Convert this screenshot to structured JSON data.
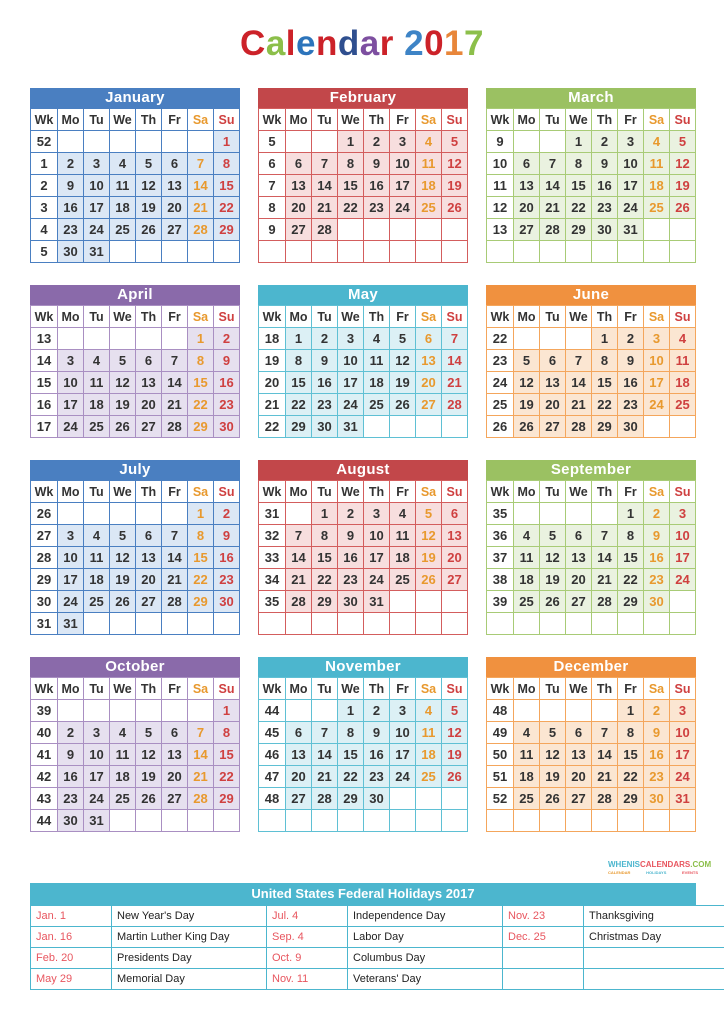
{
  "title": {
    "letters": [
      {
        "ch": "C",
        "color": "#cc2229"
      },
      {
        "ch": "a",
        "color": "#8cbf4a"
      },
      {
        "ch": "l",
        "color": "#cc2229"
      },
      {
        "ch": "e",
        "color": "#2c74bb"
      },
      {
        "ch": "n",
        "color": "#cc2229"
      },
      {
        "ch": "d",
        "color": "#2f4f8f"
      },
      {
        "ch": "a",
        "color": "#7d4fa0"
      },
      {
        "ch": "r",
        "color": "#cc2229"
      },
      {
        "ch": " ",
        "color": "#000000"
      },
      {
        "ch": "2",
        "color": "#3e84c6"
      },
      {
        "ch": "0",
        "color": "#cc2229"
      },
      {
        "ch": "1",
        "color": "#e8863a"
      },
      {
        "ch": "7",
        "color": "#8cbf4a"
      }
    ],
    "text": "Calendar 2017"
  },
  "weekday_headers": [
    "Wk",
    "Mo",
    "Tu",
    "We",
    "Th",
    "Fr",
    "Sa",
    "Su"
  ],
  "palette": {
    "blue": {
      "header": "#4a7fc1",
      "border": "#4a7fc1",
      "tint": "#dbe7f5"
    },
    "red": {
      "header": "#c2474a",
      "border": "#d35d5d",
      "tint": "#f7dede"
    },
    "green": {
      "header": "#9bc162",
      "border": "#a8cb76",
      "tint": "#eaf2e0"
    },
    "purple": {
      "header": "#8a6aaa",
      "border": "#a98fc2",
      "tint": "#e6e0ef"
    },
    "cyan": {
      "header": "#4cb6ce",
      "border": "#5fc0d4",
      "tint": "#dcf0f5"
    },
    "orange": {
      "header": "#f0913f",
      "border": "#f4a65c",
      "tint": "#fbe6d2"
    },
    "saturday_text": "#e8992e",
    "sunday_text": "#cf4040",
    "day_text": "#333333"
  },
  "months": [
    {
      "name": "January",
      "color": "blue",
      "weeks": [
        {
          "wk": "52",
          "days": [
            "",
            "",
            "",
            "",
            "",
            "",
            "1"
          ]
        },
        {
          "wk": "1",
          "days": [
            "2",
            "3",
            "4",
            "5",
            "6",
            "7",
            "8"
          ]
        },
        {
          "wk": "2",
          "days": [
            "9",
            "10",
            "11",
            "12",
            "13",
            "14",
            "15"
          ]
        },
        {
          "wk": "3",
          "days": [
            "16",
            "17",
            "18",
            "19",
            "20",
            "21",
            "22"
          ]
        },
        {
          "wk": "4",
          "days": [
            "23",
            "24",
            "25",
            "26",
            "27",
            "28",
            "29"
          ]
        },
        {
          "wk": "5",
          "days": [
            "30",
            "31",
            "",
            "",
            "",
            "",
            ""
          ]
        }
      ]
    },
    {
      "name": "February",
      "color": "red",
      "weeks": [
        {
          "wk": "5",
          "days": [
            "",
            "",
            "1",
            "2",
            "3",
            "4",
            "5"
          ]
        },
        {
          "wk": "6",
          "days": [
            "6",
            "7",
            "8",
            "9",
            "10",
            "11",
            "12"
          ]
        },
        {
          "wk": "7",
          "days": [
            "13",
            "14",
            "15",
            "16",
            "17",
            "18",
            "19"
          ]
        },
        {
          "wk": "8",
          "days": [
            "20",
            "21",
            "22",
            "23",
            "24",
            "25",
            "26"
          ]
        },
        {
          "wk": "9",
          "days": [
            "27",
            "28",
            "",
            "",
            "",
            "",
            ""
          ]
        },
        {
          "wk": "",
          "days": [
            "",
            "",
            "",
            "",
            "",
            "",
            ""
          ]
        }
      ]
    },
    {
      "name": "March",
      "color": "green",
      "weeks": [
        {
          "wk": "9",
          "days": [
            "",
            "",
            "1",
            "2",
            "3",
            "4",
            "5"
          ]
        },
        {
          "wk": "10",
          "days": [
            "6",
            "7",
            "8",
            "9",
            "10",
            "11",
            "12"
          ]
        },
        {
          "wk": "11",
          "days": [
            "13",
            "14",
            "15",
            "16",
            "17",
            "18",
            "19"
          ]
        },
        {
          "wk": "12",
          "days": [
            "20",
            "21",
            "22",
            "23",
            "24",
            "25",
            "26"
          ]
        },
        {
          "wk": "13",
          "days": [
            "27",
            "28",
            "29",
            "30",
            "31",
            "",
            ""
          ]
        },
        {
          "wk": "",
          "days": [
            "",
            "",
            "",
            "",
            "",
            "",
            ""
          ]
        }
      ]
    },
    {
      "name": "April",
      "color": "purple",
      "weeks": [
        {
          "wk": "13",
          "days": [
            "",
            "",
            "",
            "",
            "",
            "1",
            "2"
          ]
        },
        {
          "wk": "14",
          "days": [
            "3",
            "4",
            "5",
            "6",
            "7",
            "8",
            "9"
          ]
        },
        {
          "wk": "15",
          "days": [
            "10",
            "11",
            "12",
            "13",
            "14",
            "15",
            "16"
          ]
        },
        {
          "wk": "16",
          "days": [
            "17",
            "18",
            "19",
            "20",
            "21",
            "22",
            "23"
          ]
        },
        {
          "wk": "17",
          "days": [
            "24",
            "25",
            "26",
            "27",
            "28",
            "29",
            "30"
          ]
        }
      ]
    },
    {
      "name": "May",
      "color": "cyan",
      "weeks": [
        {
          "wk": "18",
          "days": [
            "1",
            "2",
            "3",
            "4",
            "5",
            "6",
            "7"
          ]
        },
        {
          "wk": "19",
          "days": [
            "8",
            "9",
            "10",
            "11",
            "12",
            "13",
            "14"
          ]
        },
        {
          "wk": "20",
          "days": [
            "15",
            "16",
            "17",
            "18",
            "19",
            "20",
            "21"
          ]
        },
        {
          "wk": "21",
          "days": [
            "22",
            "23",
            "24",
            "25",
            "26",
            "27",
            "28"
          ]
        },
        {
          "wk": "22",
          "days": [
            "29",
            "30",
            "31",
            "",
            "",
            "",
            ""
          ]
        }
      ]
    },
    {
      "name": "June",
      "color": "orange",
      "weeks": [
        {
          "wk": "22",
          "days": [
            "",
            "",
            "",
            "1",
            "2",
            "3",
            "4"
          ]
        },
        {
          "wk": "23",
          "days": [
            "5",
            "6",
            "7",
            "8",
            "9",
            "10",
            "11"
          ]
        },
        {
          "wk": "24",
          "days": [
            "12",
            "13",
            "14",
            "15",
            "16",
            "17",
            "18"
          ]
        },
        {
          "wk": "25",
          "days": [
            "19",
            "20",
            "21",
            "22",
            "23",
            "24",
            "25"
          ]
        },
        {
          "wk": "26",
          "days": [
            "26",
            "27",
            "28",
            "29",
            "30",
            "",
            ""
          ]
        }
      ]
    },
    {
      "name": "July",
      "color": "blue",
      "weeks": [
        {
          "wk": "26",
          "days": [
            "",
            "",
            "",
            "",
            "",
            "1",
            "2"
          ]
        },
        {
          "wk": "27",
          "days": [
            "3",
            "4",
            "5",
            "6",
            "7",
            "8",
            "9"
          ]
        },
        {
          "wk": "28",
          "days": [
            "10",
            "11",
            "12",
            "13",
            "14",
            "15",
            "16"
          ]
        },
        {
          "wk": "29",
          "days": [
            "17",
            "18",
            "19",
            "20",
            "21",
            "22",
            "23"
          ]
        },
        {
          "wk": "30",
          "days": [
            "24",
            "25",
            "26",
            "27",
            "28",
            "29",
            "30"
          ]
        },
        {
          "wk": "31",
          "days": [
            "31",
            "",
            "",
            "",
            "",
            "",
            ""
          ]
        }
      ]
    },
    {
      "name": "August",
      "color": "red",
      "weeks": [
        {
          "wk": "31",
          "days": [
            "",
            "1",
            "2",
            "3",
            "4",
            "5",
            "6"
          ]
        },
        {
          "wk": "32",
          "days": [
            "7",
            "8",
            "9",
            "10",
            "11",
            "12",
            "13"
          ]
        },
        {
          "wk": "33",
          "days": [
            "14",
            "15",
            "16",
            "17",
            "18",
            "19",
            "20"
          ]
        },
        {
          "wk": "34",
          "days": [
            "21",
            "22",
            "23",
            "24",
            "25",
            "26",
            "27"
          ]
        },
        {
          "wk": "35",
          "days": [
            "28",
            "29",
            "30",
            "31",
            "",
            "",
            ""
          ]
        },
        {
          "wk": "",
          "days": [
            "",
            "",
            "",
            "",
            "",
            "",
            ""
          ]
        }
      ]
    },
    {
      "name": "September",
      "color": "green",
      "weeks": [
        {
          "wk": "35",
          "days": [
            "",
            "",
            "",
            "",
            "1",
            "2",
            "3"
          ]
        },
        {
          "wk": "36",
          "days": [
            "4",
            "5",
            "6",
            "7",
            "8",
            "9",
            "10"
          ]
        },
        {
          "wk": "37",
          "days": [
            "11",
            "12",
            "13",
            "14",
            "15",
            "16",
            "17"
          ]
        },
        {
          "wk": "38",
          "days": [
            "18",
            "19",
            "20",
            "21",
            "22",
            "23",
            "24"
          ]
        },
        {
          "wk": "39",
          "days": [
            "25",
            "26",
            "27",
            "28",
            "29",
            "30",
            ""
          ]
        },
        {
          "wk": "",
          "days": [
            "",
            "",
            "",
            "",
            "",
            "",
            ""
          ]
        }
      ]
    },
    {
      "name": "October",
      "color": "purple",
      "weeks": [
        {
          "wk": "39",
          "days": [
            "",
            "",
            "",
            "",
            "",
            "",
            "1"
          ]
        },
        {
          "wk": "40",
          "days": [
            "2",
            "3",
            "4",
            "5",
            "6",
            "7",
            "8"
          ]
        },
        {
          "wk": "41",
          "days": [
            "9",
            "10",
            "11",
            "12",
            "13",
            "14",
            "15"
          ]
        },
        {
          "wk": "42",
          "days": [
            "16",
            "17",
            "18",
            "19",
            "20",
            "21",
            "22"
          ]
        },
        {
          "wk": "43",
          "days": [
            "23",
            "24",
            "25",
            "26",
            "27",
            "28",
            "29"
          ]
        },
        {
          "wk": "44",
          "days": [
            "30",
            "31",
            "",
            "",
            "",
            "",
            ""
          ]
        }
      ]
    },
    {
      "name": "November",
      "color": "cyan",
      "weeks": [
        {
          "wk": "44",
          "days": [
            "",
            "",
            "1",
            "2",
            "3",
            "4",
            "5"
          ]
        },
        {
          "wk": "45",
          "days": [
            "6",
            "7",
            "8",
            "9",
            "10",
            "11",
            "12"
          ]
        },
        {
          "wk": "46",
          "days": [
            "13",
            "14",
            "15",
            "16",
            "17",
            "18",
            "19"
          ]
        },
        {
          "wk": "47",
          "days": [
            "20",
            "21",
            "22",
            "23",
            "24",
            "25",
            "26"
          ]
        },
        {
          "wk": "48",
          "days": [
            "27",
            "28",
            "29",
            "30",
            "",
            "",
            ""
          ]
        },
        {
          "wk": "",
          "days": [
            "",
            "",
            "",
            "",
            "",
            "",
            ""
          ]
        }
      ]
    },
    {
      "name": "December",
      "color": "orange",
      "weeks": [
        {
          "wk": "48",
          "days": [
            "",
            "",
            "",
            "",
            "1",
            "2",
            "3"
          ]
        },
        {
          "wk": "49",
          "days": [
            "4",
            "5",
            "6",
            "7",
            "8",
            "9",
            "10"
          ]
        },
        {
          "wk": "50",
          "days": [
            "11",
            "12",
            "13",
            "14",
            "15",
            "16",
            "17"
          ]
        },
        {
          "wk": "51",
          "days": [
            "18",
            "19",
            "20",
            "21",
            "22",
            "23",
            "24"
          ]
        },
        {
          "wk": "52",
          "days": [
            "25",
            "26",
            "27",
            "28",
            "29",
            "30",
            "31"
          ]
        },
        {
          "wk": "",
          "days": [
            "",
            "",
            "",
            "",
            "",
            "",
            ""
          ]
        }
      ]
    }
  ],
  "watermark": {
    "parts": [
      {
        "text": "WHENIS",
        "color": "#4cb6ce"
      },
      {
        "text": "CALENDARS",
        "color": "#e8565f"
      },
      {
        "text": ".COM",
        "color": "#8cbf4a"
      }
    ],
    "sub_parts": [
      {
        "text": "CALENDAR",
        "color": "#e8992e"
      },
      {
        "text": "HOLIDAYS",
        "color": "#4cb6ce"
      },
      {
        "text": "EVENTS",
        "color": "#e8565f"
      }
    ]
  },
  "holidays": {
    "title": "United States Federal Holidays 2017",
    "header_color": "#4cb6ce",
    "date_color": "#e8565f",
    "rows": [
      [
        {
          "date": "Jan. 1",
          "name": "New Year's Day"
        },
        {
          "date": "Jul. 4",
          "name": "Independence Day"
        },
        {
          "date": "Nov. 23",
          "name": "Thanksgiving"
        }
      ],
      [
        {
          "date": "Jan. 16",
          "name": "Martin Luther King Day"
        },
        {
          "date": "Sep. 4",
          "name": "Labor Day"
        },
        {
          "date": "Dec. 25",
          "name": "Christmas Day"
        }
      ],
      [
        {
          "date": "Feb. 20",
          "name": "Presidents Day"
        },
        {
          "date": "Oct. 9",
          "name": "Columbus Day"
        },
        {
          "date": "",
          "name": ""
        }
      ],
      [
        {
          "date": "May 29",
          "name": "Memorial Day"
        },
        {
          "date": "Nov. 11",
          "name": "Veterans' Day"
        },
        {
          "date": "",
          "name": ""
        }
      ]
    ]
  }
}
